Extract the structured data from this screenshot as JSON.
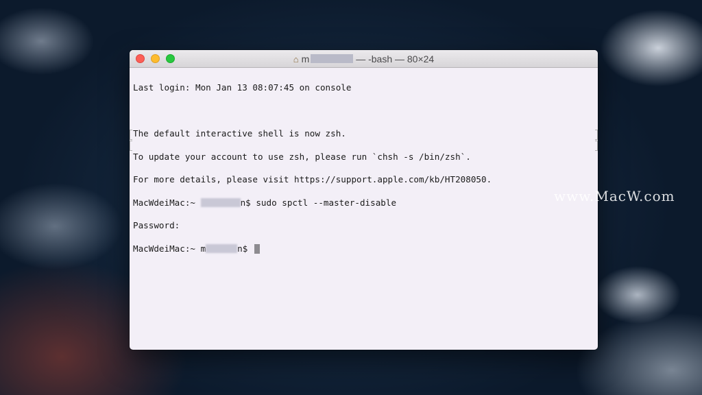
{
  "window": {
    "title_user": "m",
    "title_rest": " — -bash — 80×24"
  },
  "terminal": {
    "line1": "Last login: Mon Jan 13 08:07:45 on console",
    "line2": "",
    "line3": "The default interactive shell is now zsh.",
    "line4": "To update your account to use zsh, please run `chsh -s /bin/zsh`.",
    "line5": "For more details, please visit https://support.apple.com/kb/HT208050.",
    "line6_prefix": "MacWdeiMac:~ ",
    "line6_user_end": "n",
    "line6_command": "$ sudo spctl --master-disable",
    "line7": "Password:",
    "line8_prefix": "MacWdeiMac:~ ",
    "line8_user_start": "m",
    "line8_user_end": "n",
    "line8_prompt": "$ "
  },
  "watermark": "www.MacW.com",
  "icons": {
    "home": "home-icon"
  }
}
